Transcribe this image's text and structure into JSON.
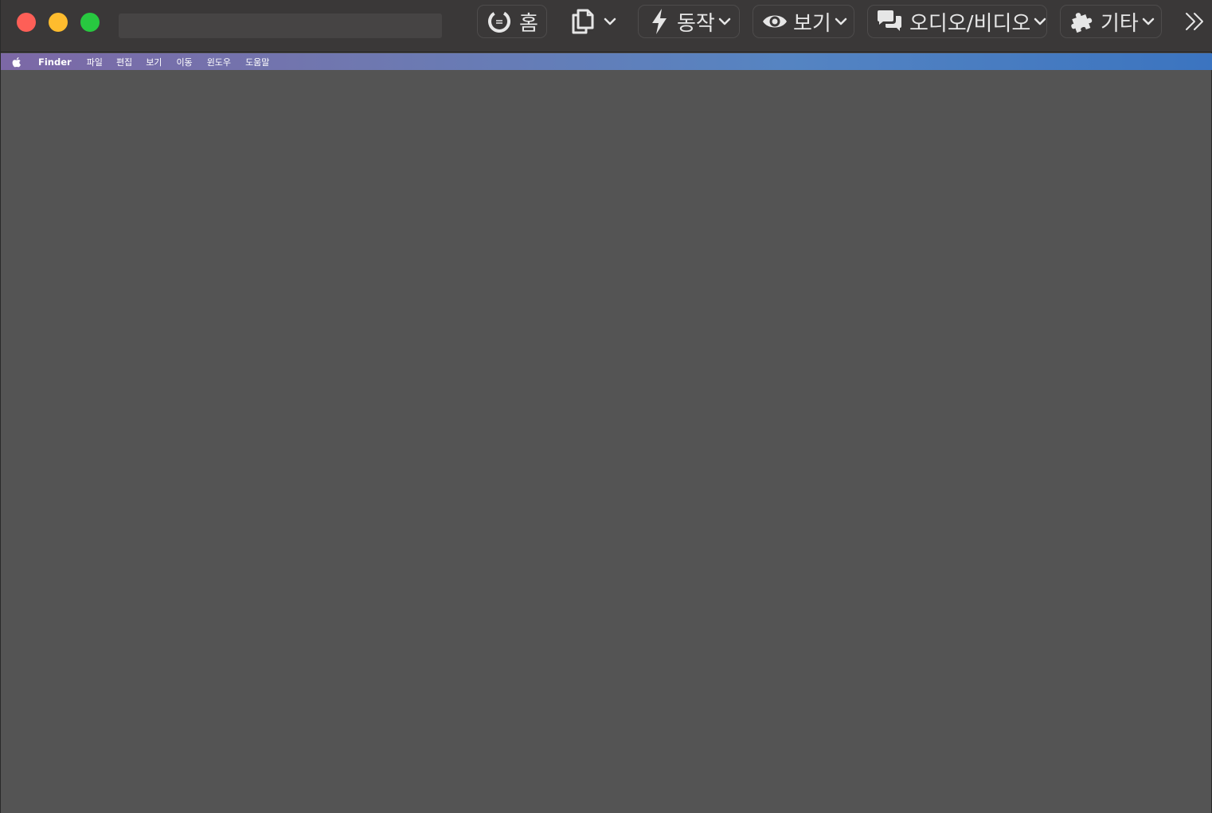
{
  "window": {
    "toolbar": {
      "address_value": "",
      "buttons": [
        {
          "id": "home",
          "label": "홈",
          "icon": "home-circle-icon",
          "has_dropdown": false
        },
        {
          "id": "copy",
          "label": "",
          "icon": "copy-icon",
          "has_dropdown": true
        },
        {
          "id": "actions",
          "label": "동작",
          "icon": "lightning-icon",
          "has_dropdown": true
        },
        {
          "id": "view",
          "label": "보기",
          "icon": "eye-icon",
          "has_dropdown": true
        },
        {
          "id": "audio_video",
          "label": "오디오/비디오",
          "icon": "chat-bubbles-icon",
          "has_dropdown": true
        },
        {
          "id": "other",
          "label": "기타",
          "icon": "puzzle-icon",
          "has_dropdown": true
        }
      ],
      "overflow_icon": "double-chevron-right-icon"
    }
  },
  "menubar": {
    "apple_icon": "apple-logo-icon",
    "app_name": "Finder",
    "items": [
      "파일",
      "편집",
      "보기",
      "이동",
      "윈도우",
      "도움말"
    ]
  },
  "colors": {
    "toolbar_bg": "#3a3838",
    "content_bg": "#545454",
    "close": "#fe5f57",
    "minimize": "#febc2e",
    "maximize": "#28c840",
    "menubar_gradient_start": "#7c68a6",
    "menubar_gradient_end": "#3b74c0"
  }
}
